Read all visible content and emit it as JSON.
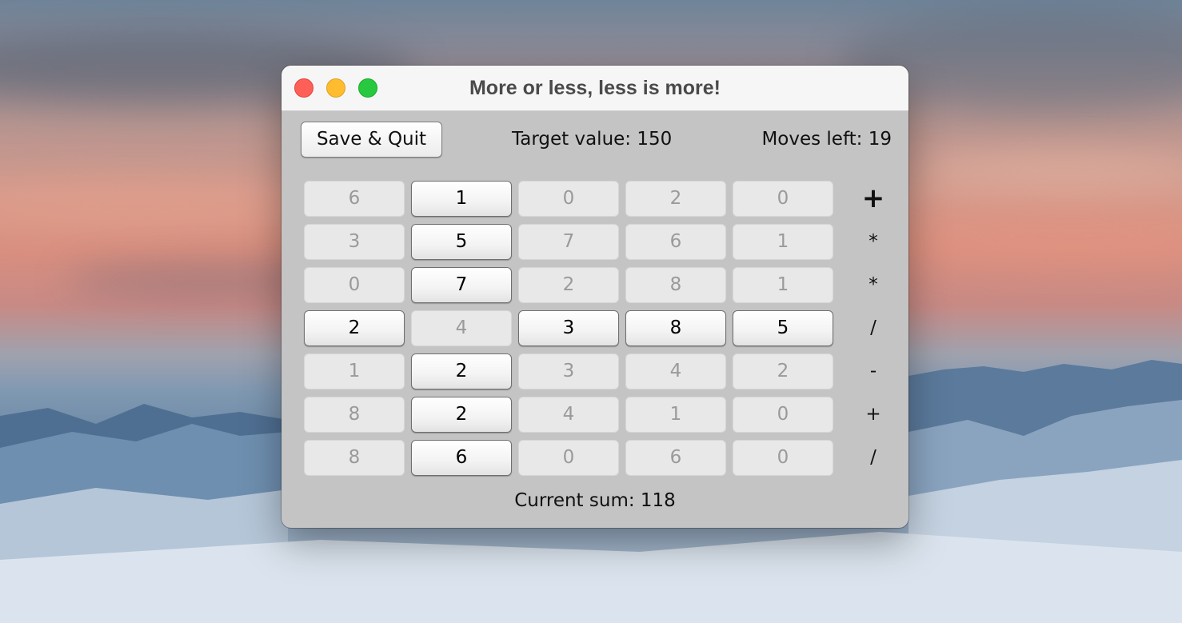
{
  "window": {
    "title": "More or less, less is more!"
  },
  "header": {
    "save_quit_label": "Save & Quit",
    "target_label": "Target value: 150",
    "moves_label": "Moves left: 19"
  },
  "grid": {
    "rows": [
      {
        "cells": [
          {
            "value": "6",
            "active": false
          },
          {
            "value": "1",
            "active": true
          },
          {
            "value": "0",
            "active": false
          },
          {
            "value": "2",
            "active": false
          },
          {
            "value": "0",
            "active": false
          }
        ],
        "op": "+",
        "op_bold": true
      },
      {
        "cells": [
          {
            "value": "3",
            "active": false
          },
          {
            "value": "5",
            "active": true
          },
          {
            "value": "7",
            "active": false
          },
          {
            "value": "6",
            "active": false
          },
          {
            "value": "1",
            "active": false
          }
        ],
        "op": "*",
        "op_bold": false
      },
      {
        "cells": [
          {
            "value": "0",
            "active": false
          },
          {
            "value": "7",
            "active": true
          },
          {
            "value": "2",
            "active": false
          },
          {
            "value": "8",
            "active": false
          },
          {
            "value": "1",
            "active": false
          }
        ],
        "op": "*",
        "op_bold": false
      },
      {
        "cells": [
          {
            "value": "2",
            "active": true
          },
          {
            "value": "4",
            "active": false
          },
          {
            "value": "3",
            "active": true
          },
          {
            "value": "8",
            "active": true
          },
          {
            "value": "5",
            "active": true
          }
        ],
        "op": "/",
        "op_bold": false
      },
      {
        "cells": [
          {
            "value": "1",
            "active": false
          },
          {
            "value": "2",
            "active": true
          },
          {
            "value": "3",
            "active": false
          },
          {
            "value": "4",
            "active": false
          },
          {
            "value": "2",
            "active": false
          }
        ],
        "op": "-",
        "op_bold": false
      },
      {
        "cells": [
          {
            "value": "8",
            "active": false
          },
          {
            "value": "2",
            "active": true
          },
          {
            "value": "4",
            "active": false
          },
          {
            "value": "1",
            "active": false
          },
          {
            "value": "0",
            "active": false
          }
        ],
        "op": "+",
        "op_bold": false
      },
      {
        "cells": [
          {
            "value": "8",
            "active": false
          },
          {
            "value": "6",
            "active": true
          },
          {
            "value": "0",
            "active": false
          },
          {
            "value": "6",
            "active": false
          },
          {
            "value": "0",
            "active": false
          }
        ],
        "op": "/",
        "op_bold": false
      }
    ]
  },
  "footer": {
    "sum_label": "Current sum: 118"
  }
}
